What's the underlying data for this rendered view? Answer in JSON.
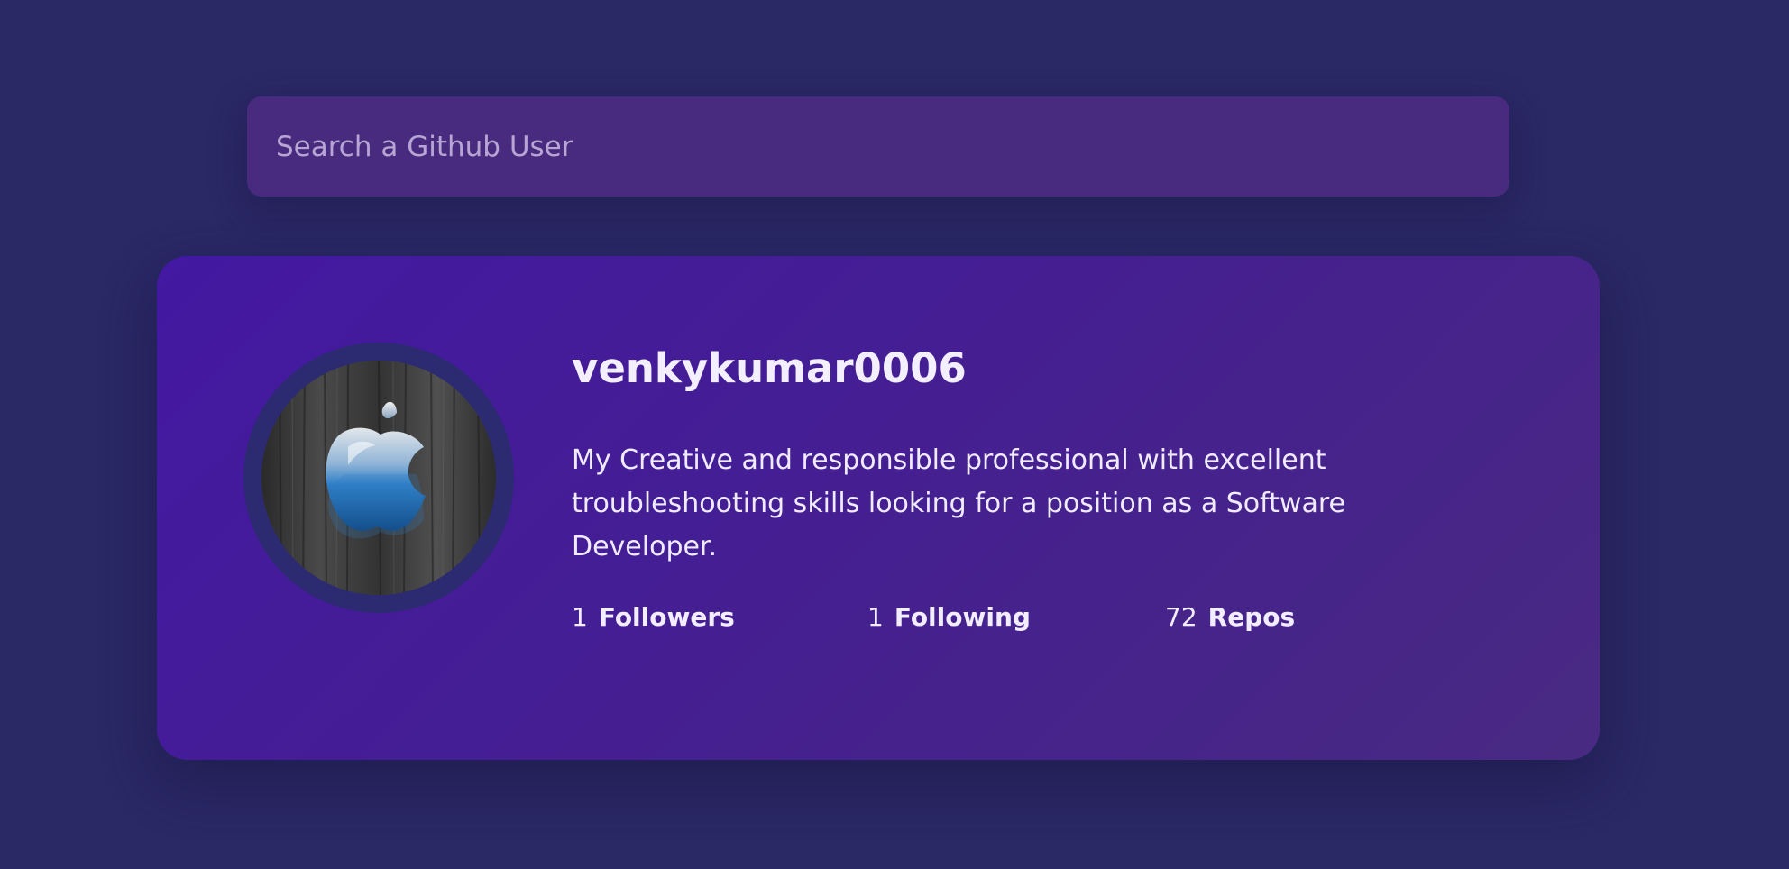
{
  "search": {
    "placeholder": "Search a Github User"
  },
  "profile": {
    "username": "venkykumar0006",
    "bio": "My Creative and responsible professional with excellent troubleshooting skills looking for a position as a Software Developer.",
    "avatar_icon": "apple-logo-icon",
    "stats": {
      "followers": {
        "count": "1",
        "label": "Followers"
      },
      "following": {
        "count": "1",
        "label": "Following"
      },
      "repos": {
        "count": "72",
        "label": "Repos"
      }
    }
  },
  "colors": {
    "background": "#2a2865",
    "search_bg": "#482a7f",
    "card_bg_start": "#4318a2",
    "card_bg_end": "#482a82",
    "avatar_ring": "#2c2a70",
    "text": "#f3efff"
  }
}
